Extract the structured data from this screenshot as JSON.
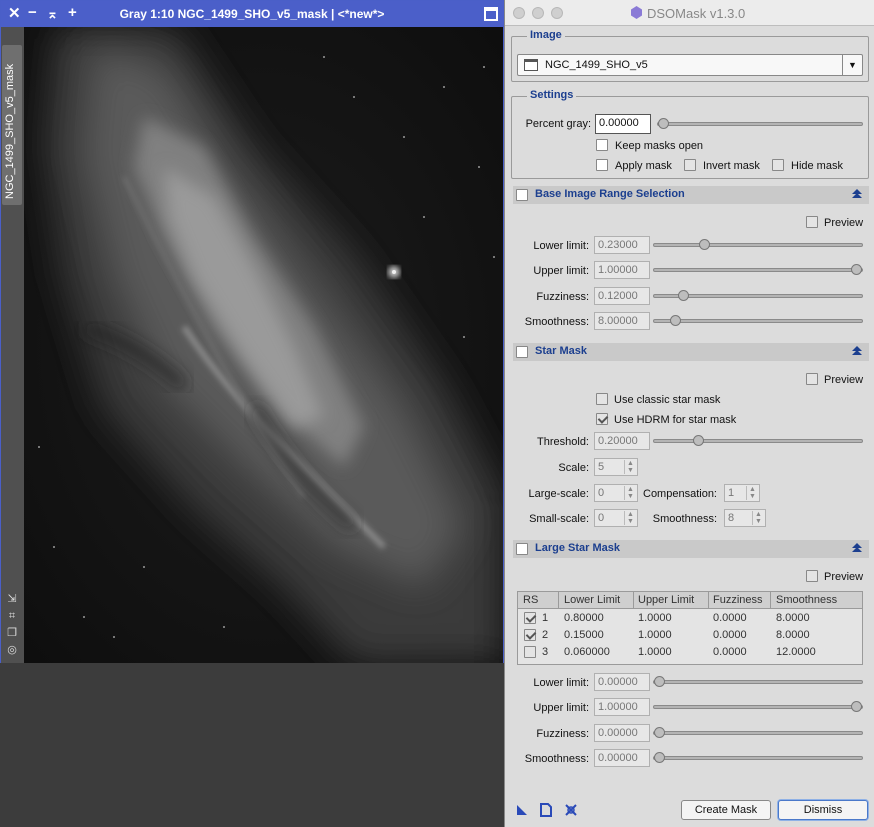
{
  "image_window": {
    "title": "Gray 1:10 NGC_1499_SHO_v5_mask | <*new*>",
    "close_glyph": "✕",
    "minimize_glyph": "−",
    "shade_glyph": "⌅",
    "plus_glyph": "+",
    "side_tab_label": "NGC_1499_SHO_v5_mask",
    "side_icons": [
      "expand-icon",
      "fit-icon",
      "copy-icon",
      "target-icon"
    ]
  },
  "dialog": {
    "title": "DSOMask v1.3.0",
    "image_group": {
      "label": "Image",
      "selected": "NGC_1499_SHO_v5"
    },
    "settings_group": {
      "label": "Settings",
      "percent_gray_label": "Percent gray:",
      "percent_gray_value": "0.00000",
      "percent_gray_level": 0.0,
      "keep_masks_open": "Keep masks open",
      "apply_mask": "Apply mask",
      "invert_mask": "Invert mask",
      "hide_mask": "Hide mask"
    },
    "base_range": {
      "title": "Base Image Range Selection",
      "preview": "Preview",
      "lower_label": "Lower limit:",
      "lower_value": "0.23000",
      "lower_level": 0.23,
      "upper_label": "Upper limit:",
      "upper_value": "1.00000",
      "upper_level": 1.0,
      "fuzziness_label": "Fuzziness:",
      "fuzziness_value": "0.12000",
      "fuzziness_level": 0.12,
      "smoothness_label": "Smoothness:",
      "smoothness_value": "8.00000",
      "smoothness_level": 0.08
    },
    "star_mask": {
      "title": "Star Mask",
      "preview": "Preview",
      "classic": "Use classic star mask",
      "hdrm": "Use HDRM for star mask",
      "threshold_label": "Threshold:",
      "threshold_value": "0.20000",
      "threshold_level": 0.2,
      "scale_label": "Scale:",
      "scale_value": "5",
      "large_scale_label": "Large-scale:",
      "large_scale_value": "0",
      "compensation_label": "Compensation:",
      "compensation_value": "1",
      "small_scale_label": "Small-scale:",
      "small_scale_value": "0",
      "smoothness_label": "Smoothness:",
      "smoothness_value": "8"
    },
    "large_star_mask": {
      "title": "Large Star Mask",
      "preview": "Preview",
      "columns": [
        "RS",
        "Lower Limit",
        "Upper Limit",
        "Fuzziness",
        "Smoothness"
      ],
      "rows": [
        {
          "checked": true,
          "rs": "1",
          "lower": "0.80000",
          "upper": "1.0000",
          "fuzz": "0.0000",
          "smooth": "8.0000"
        },
        {
          "checked": true,
          "rs": "2",
          "lower": "0.15000",
          "upper": "1.0000",
          "fuzz": "0.0000",
          "smooth": "8.0000"
        },
        {
          "checked": false,
          "rs": "3",
          "lower": "0.060000",
          "upper": "1.0000",
          "fuzz": "0.0000",
          "smooth": "12.0000"
        }
      ],
      "lower_label": "Lower limit:",
      "lower_value": "0.00000",
      "lower_level": 0.0,
      "upper_label": "Upper limit:",
      "upper_value": "1.00000",
      "upper_level": 1.0,
      "fuzziness_label": "Fuzziness:",
      "fuzziness_value": "0.00000",
      "fuzziness_level": 0.0,
      "smoothness_label": "Smoothness:",
      "smoothness_value": "0.00000",
      "smoothness_level": 0.0
    },
    "footer": {
      "create_mask": "Create Mask",
      "dismiss": "Dismiss",
      "icons": [
        "new-instance-icon",
        "document-icon",
        "reset-icon"
      ]
    }
  },
  "colors": {
    "title_bar": "#4b5fc9",
    "section_text": "#1c3f8f",
    "dialog_bg": "#dcdcdc"
  }
}
